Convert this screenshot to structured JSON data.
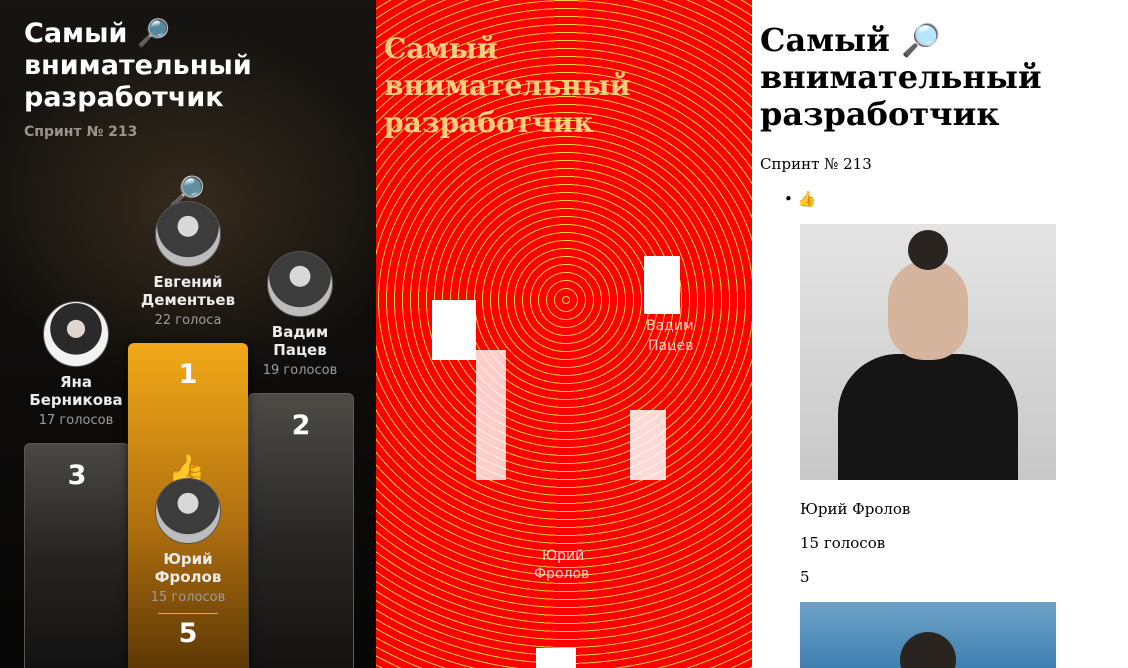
{
  "leaderboard": {
    "title": "Самый 🔎 внимательный разработчик",
    "subtitle": "Спринт № 213",
    "emoji_top": "🔎",
    "emoji_current": "👍",
    "winners": [
      {
        "rank": "1",
        "name": "Евгений Дементьев",
        "votes": "22 голоса"
      },
      {
        "rank": "2",
        "name": "Вадим Пацев",
        "votes": "19 голосов"
      },
      {
        "rank": "3",
        "name": "Яна Берникова",
        "votes": "17 голосов"
      }
    ],
    "current_user": {
      "name": "Юрий Фролов",
      "votes": "15 голосов",
      "rank": "5"
    }
  },
  "diff": {
    "title_line1": "Самый",
    "title_line2": "внимательный",
    "title_line3": "разработчик",
    "names": {
      "n1": "Вадим",
      "n2": "Пацев",
      "n3": "Юрий",
      "n4": "Фролов"
    }
  },
  "document": {
    "title": "Самый 🔎 внимательный разработчик",
    "subtitle": "Спринт № 213",
    "bullet": "👍",
    "user_name": "Юрий Фролов",
    "user_votes": "15 голосов",
    "user_rank": "5"
  },
  "colors": {
    "gold": "#f2aa18",
    "diff_red": "#ff0000",
    "diff_yellow": "#ffcc33"
  }
}
